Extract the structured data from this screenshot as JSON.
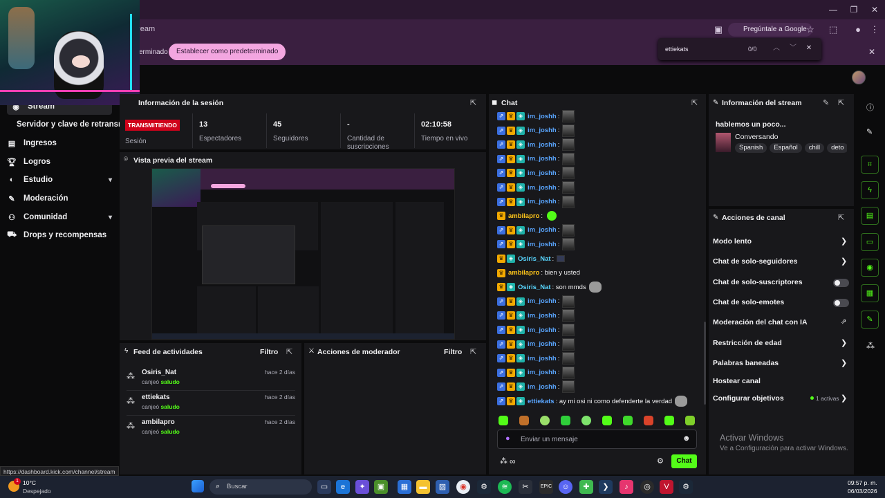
{
  "browser": {
    "address_fragment": "tream",
    "ask_google": "Pregúntale a Google",
    "infobar_text": "erminado",
    "set_default": "Establecer como predeterminado",
    "find_query": "ettiekats",
    "find_count": "0/0",
    "status_url": "https://dashboard.kick.com/channel/stream"
  },
  "sidebar": {
    "items": [
      {
        "label": "Stream",
        "icon": "broadcast-icon"
      },
      {
        "label": "Servidor y clave de retransm",
        "icon": ""
      },
      {
        "label": "Ingresos",
        "icon": "money-icon"
      },
      {
        "label": "Logros",
        "icon": "trophy-icon"
      },
      {
        "label": "Estudio",
        "icon": "palette-icon"
      },
      {
        "label": "Moderación",
        "icon": "wrench-icon"
      },
      {
        "label": "Comunidad",
        "icon": "people-icon"
      },
      {
        "label": "Drops y recompensas",
        "icon": "gift-icon"
      }
    ]
  },
  "session": {
    "title": "Información de la sesión",
    "live_badge": "TRANSMITIENDO",
    "session_label": "Sesión",
    "stats": [
      {
        "value": "13",
        "label": "Espectadores"
      },
      {
        "value": "45",
        "label": "Seguidores"
      },
      {
        "value": "-",
        "label": "Cantidad de suscripciones"
      },
      {
        "value": "02:10:58",
        "label": "Tiempo en vivo"
      }
    ]
  },
  "preview": {
    "title": "Vista previa del stream"
  },
  "feed": {
    "title": "Feed de actividades",
    "filter": "Filtro",
    "items": [
      {
        "name": "Osiris_Nat",
        "action": "canjeó",
        "reward": "saludo",
        "time": "hace 2 días"
      },
      {
        "name": "ettiekats",
        "action": "canjeó",
        "reward": "saludo",
        "time": "hace 2 días"
      },
      {
        "name": "ambilapro",
        "action": "canjeó",
        "reward": "saludo",
        "time": "hace 2 días"
      }
    ]
  },
  "modactions": {
    "title": "Acciones de moderador",
    "filter": "Filtro"
  },
  "chat": {
    "title": "Chat",
    "messages": [
      {
        "user": "im_joshh",
        "color": "blue",
        "text": ":",
        "kind": "emote"
      },
      {
        "user": "im_joshh",
        "color": "blue",
        "text": ":",
        "kind": "emote"
      },
      {
        "user": "im_joshh",
        "color": "blue",
        "text": ":",
        "kind": "emote"
      },
      {
        "user": "im_joshh",
        "color": "blue",
        "text": ":",
        "kind": "emote"
      },
      {
        "user": "im_joshh",
        "color": "blue",
        "text": ":",
        "kind": "emote"
      },
      {
        "user": "im_joshh",
        "color": "blue",
        "text": ":",
        "kind": "emote"
      },
      {
        "user": "im_joshh",
        "color": "blue",
        "text": ":",
        "kind": "emote"
      },
      {
        "user": "ambilapro",
        "color": "gold",
        "text": ":",
        "kind": "green"
      },
      {
        "user": "im_joshh",
        "color": "blue",
        "text": ":",
        "kind": "emote"
      },
      {
        "user": "im_joshh",
        "color": "blue",
        "text": ":",
        "kind": "emote"
      },
      {
        "user": "Osiris_Nat",
        "color": "cyan",
        "text": ":",
        "kind": "small"
      },
      {
        "user": "ambilapro",
        "color": "gold",
        "text": ": bien y usted",
        "kind": "none"
      },
      {
        "user": "Osiris_Nat",
        "color": "cyan",
        "text": ": son mmds",
        "kind": "cat"
      },
      {
        "user": "im_joshh",
        "color": "blue",
        "text": ":",
        "kind": "emote"
      },
      {
        "user": "im_joshh",
        "color": "blue",
        "text": ":",
        "kind": "emote"
      },
      {
        "user": "im_joshh",
        "color": "blue",
        "text": ":",
        "kind": "emote"
      },
      {
        "user": "im_joshh",
        "color": "blue",
        "text": ":",
        "kind": "emote"
      },
      {
        "user": "im_joshh",
        "color": "blue",
        "text": ":",
        "kind": "emote"
      },
      {
        "user": "im_joshh",
        "color": "blue",
        "text": ":",
        "kind": "emote"
      },
      {
        "user": "im_joshh",
        "color": "blue",
        "text": ":",
        "kind": "emote"
      },
      {
        "user": "ettiekats",
        "color": "blue",
        "text": ": ay mi osi ni como defenderte la verdad",
        "kind": "cat"
      }
    ],
    "input_placeholder": "Enviar un mensaje",
    "send": "Chat"
  },
  "stream_info": {
    "title": "Información del stream",
    "stream_title": "hablemos un poco...",
    "category": "Conversando",
    "tags": [
      "Spanish",
      "Español",
      "chill",
      "deto"
    ]
  },
  "channel_actions": {
    "title": "Acciones de canal",
    "items": [
      {
        "label": "Modo lento",
        "control": "chevron"
      },
      {
        "label": "Chat de solo-seguidores",
        "control": "chevron"
      },
      {
        "label": "Chat de solo-suscriptores",
        "control": "toggle"
      },
      {
        "label": "Chat de solo-emotes",
        "control": "toggle"
      },
      {
        "label": "Moderación del chat con IA",
        "control": "external"
      },
      {
        "label": "Restricción de edad",
        "control": "chevron"
      },
      {
        "label": "Palabras baneadas",
        "control": "chevron"
      },
      {
        "label": "Hostear canal",
        "control": "none"
      },
      {
        "label": "Configurar objetivos",
        "control": "chevron"
      }
    ],
    "goals_status": "1 activas"
  },
  "windows": {
    "activate_title": "Activar Windows",
    "activate_sub": "Ve a Configuración para activar Windows.",
    "weather_temp": "10°C",
    "weather_desc": "Despejado",
    "search": "Buscar",
    "time": "09:57 p. m.",
    "date": "06/03/2026",
    "notif_count": "1"
  },
  "colors": {
    "accent": "#53fc18",
    "live": "#d0021b",
    "panel": "#18181b"
  }
}
